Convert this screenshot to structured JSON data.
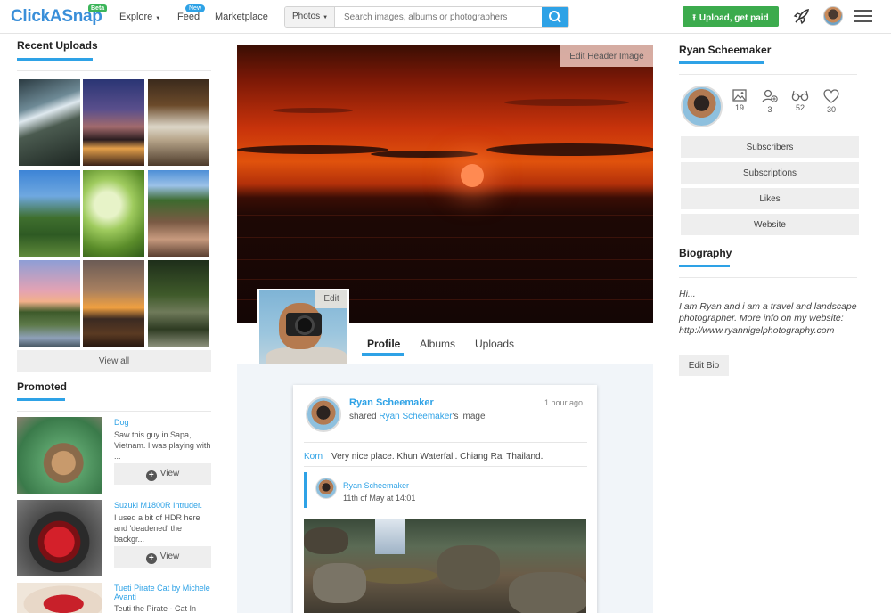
{
  "topbar": {
    "logo": "ClickASnap",
    "logo_badge": "Beta",
    "nav": {
      "explore": "Explore",
      "feed": "Feed",
      "feed_badge": "New",
      "marketplace": "Marketplace"
    },
    "search": {
      "scope": "Photos",
      "placeholder": "Search images, albums or photographers"
    },
    "upload_label": "Upload, get paid"
  },
  "left": {
    "recent_title": "Recent Uploads",
    "view_all": "View all",
    "promoted_title": "Promoted",
    "promoted": [
      {
        "title": "Dog",
        "desc": "Saw this guy in Sapa, Vietnam. I was playing with ...",
        "view": "View"
      },
      {
        "title": "Suzuki M1800R Intruder.",
        "desc": "I used a bit of HDR here and 'deadened' the backgr...",
        "view": "View"
      },
      {
        "title": "Tueti Pirate Cat by Michele Avanti",
        "desc": "Teuti the Pirate - Cat In"
      }
    ]
  },
  "center": {
    "edit_header": "Edit Header Image",
    "edit_avatar": "Edit",
    "tabs": [
      "Profile",
      "Albums",
      "Uploads"
    ],
    "post": {
      "name": "Ryan Scheemaker",
      "shared_prefix": "shared",
      "shared_user": "Ryan Scheemaker",
      "shared_suffix": "'s image",
      "time": "1 hour ago",
      "comment_user": "Korn",
      "comment_text": "Very nice place. Khun Waterfall. Chiang Rai Thailand.",
      "quote_name": "Ryan Scheemaker",
      "quote_date": "11th of May at 14:01"
    }
  },
  "right": {
    "name": "Ryan Scheemaker",
    "stats": {
      "photos": "19",
      "subscribers": "3",
      "views": "52",
      "likes": "30"
    },
    "buttons": [
      "Subscribers",
      "Subscriptions",
      "Likes",
      "Website"
    ],
    "bio_title": "Biography",
    "bio_lines": [
      "Hi...",
      "I am Ryan and i am a travel and landscape photographer. More info on my website:",
      "http://www.ryannigelphotography.com"
    ],
    "edit_bio": "Edit Bio"
  },
  "colors": {
    "accent": "#2ea2e6",
    "upload_green": "#3cab4d"
  }
}
